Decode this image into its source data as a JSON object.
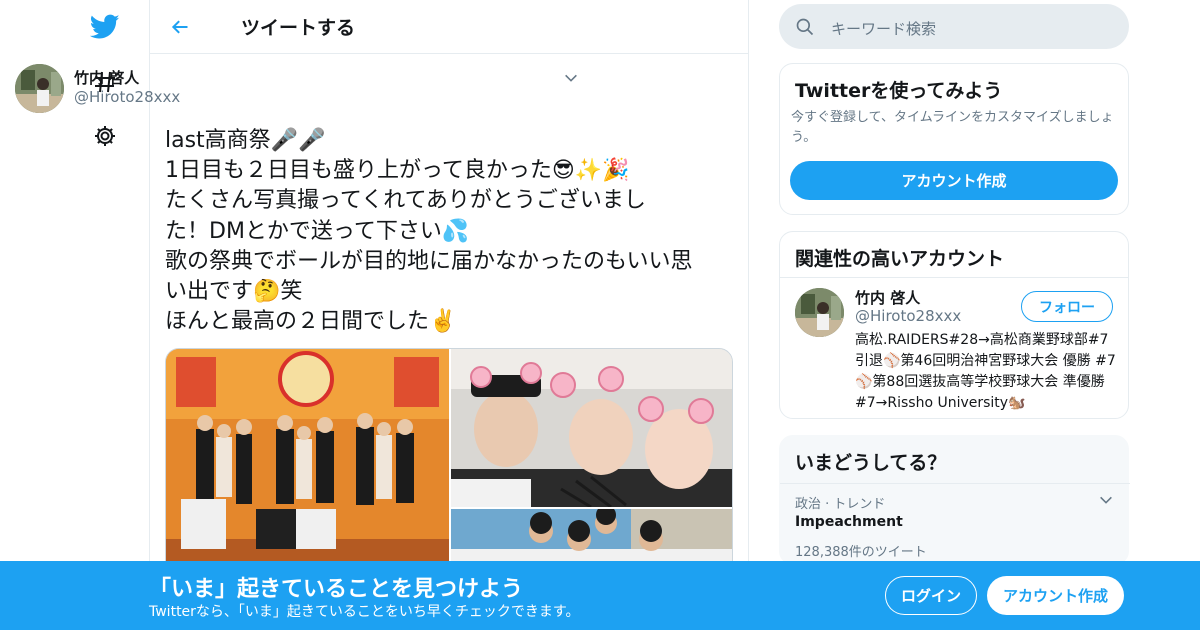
{
  "colors": {
    "accent": "#1da1f2",
    "border": "#e6ecf0",
    "muted": "#657786",
    "text": "#14171a"
  },
  "nav": {
    "logo_icon": "twitter-bird-icon",
    "explore_icon": "hashtag-icon",
    "settings_icon": "gear-icon"
  },
  "header": {
    "title": "ツイートする",
    "back_icon": "arrow-left-icon"
  },
  "tweet": {
    "author_name": "竹内 啓人",
    "author_handle": "@Hiroto28xxx",
    "text": "last高商祭🎤🎤\n1日目も２日目も盛り上がって良かった😎✨🎉\nたくさん写真撮ってくれてありがとうございまし\nた！DMとかで送って下さい💦\n歌の祭典でボールが目的地に届かなかったのもいい思\nい出です🤔笑\nほんと最高の２日間でした✌️"
  },
  "search": {
    "placeholder": "キーワード検索"
  },
  "signup_card": {
    "title": "Twitterを使ってみよう",
    "subtitle": "今すぐ登録して、タイムラインをカスタマイズしましょう。",
    "button": "アカウント作成"
  },
  "related": {
    "title": "関連性の高いアカウント",
    "name": "竹内 啓人",
    "handle": "@Hiroto28xxx",
    "follow": "フォロー",
    "bio": "高松.RAIDERS#28→高松商業野球部#7 引退⚾第46回明治神宮野球大会 優勝 #7⚾第88回選抜高等学校野球大会 準優勝 #7→Rissho University🐿️"
  },
  "trends": {
    "title": "いまどうしてる？",
    "items": [
      {
        "category": "政治 · トレンド",
        "name": "Impeachment",
        "count": "128,388件のツイート"
      }
    ]
  },
  "banner": {
    "title": "「いま」起きていることを見つけよう",
    "subtitle": "Twitterなら、「いま」起きていることをいち早くチェックできます。",
    "login": "ログイン",
    "signup": "アカウント作成"
  }
}
